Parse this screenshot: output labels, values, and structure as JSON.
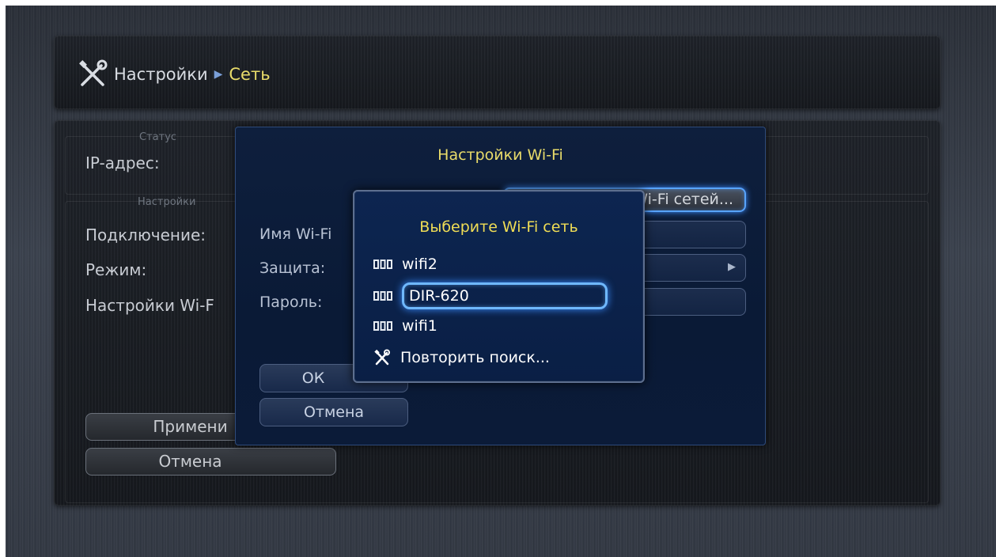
{
  "breadcrumb": {
    "icon": "tools-icon",
    "root": "Настройки",
    "separator": "▶",
    "current": "Сеть"
  },
  "background_page": {
    "status_caption": "Статус",
    "ip_label": "IP-адрес:",
    "settings_caption": "Настройки",
    "connection_label": "Подключение:",
    "mode_label": "Режим:",
    "wifi_settings_label": "Настройки Wi-F",
    "apply_button": "Примени",
    "cancel_button": "Отмена"
  },
  "wifi_dialog": {
    "title": "Настройки Wi-Fi",
    "scan_button": "Wi-Fi сетей...",
    "name_label": "Имя Wi-Fi",
    "security_label": "Защита:",
    "password_label": "Пароль:",
    "ok_button": "ОК",
    "cancel_button": "Отмена"
  },
  "network_picker": {
    "title": "Выберите Wi-Fi сеть",
    "networks": [
      {
        "name": "wifi2",
        "icon": "signal-strength-icon"
      },
      {
        "name": "DIR-620",
        "icon": "signal-strength-icon",
        "selected": true
      },
      {
        "name": "wifi1",
        "icon": "signal-strength-icon"
      }
    ],
    "rescan": {
      "label": "Повторить поиск...",
      "icon": "tools-icon"
    }
  },
  "colors": {
    "accent_yellow": "#e9dc6a",
    "focus_blue": "#58a4ff",
    "dialog_bg": "#0e1f3d"
  }
}
